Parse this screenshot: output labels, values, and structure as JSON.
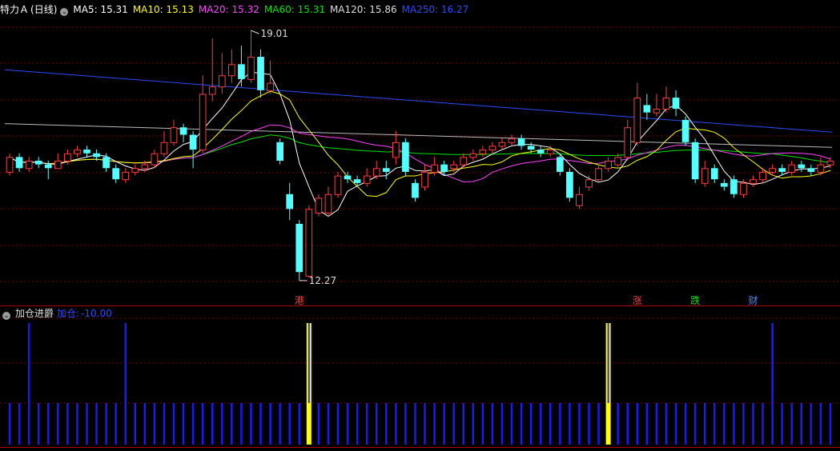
{
  "header": {
    "stock_name": "特力Ａ",
    "period": "(日线)",
    "ma": [
      {
        "label": "MA5: 15.31",
        "color": "#ffffff"
      },
      {
        "label": "MA10: 15.13",
        "color": "#ffff00"
      },
      {
        "label": "MA20: 15.32",
        "color": "#ff44ff"
      },
      {
        "label": "MA60: 15.31",
        "color": "#00e400"
      },
      {
        "label": "MA120: 15.86",
        "color": "#dddddd"
      },
      {
        "label": "MA250: 16.27",
        "color": "#2a4bff"
      }
    ]
  },
  "indicator": {
    "name": "加仓进爵",
    "label": "加仓:",
    "value": "-10.00"
  },
  "bottom_cut": "...",
  "chart_data": {
    "type": "candlestick",
    "price_range": [
      11.6,
      19.4
    ],
    "high_marker": "19.01",
    "low_marker": "12.27",
    "high_index": 25,
    "low_index": 30,
    "events": [
      {
        "index": 30,
        "text": "港",
        "color": "#ff4040"
      },
      {
        "index": 65,
        "text": "涨",
        "color": "#ff4040"
      },
      {
        "index": 71,
        "text": "跌",
        "color": "#00e400"
      },
      {
        "index": 77,
        "text": "财",
        "color": "#4a8cff"
      }
    ],
    "colors": {
      "up": "#ff3c3c",
      "down": "#54ffff",
      "grid": "#7a0000",
      "border": "#b00000"
    },
    "candles": [
      [
        15.2,
        15.6,
        15.7,
        15.1
      ],
      [
        15.6,
        15.3,
        15.7,
        15.2
      ],
      [
        15.3,
        15.5,
        15.6,
        15.2
      ],
      [
        15.5,
        15.4,
        15.6,
        15.3
      ],
      [
        15.4,
        15.3,
        15.5,
        15.0
      ],
      [
        15.3,
        15.5,
        15.7,
        15.3
      ],
      [
        15.5,
        15.7,
        15.8,
        15.4
      ],
      [
        15.7,
        15.8,
        15.9,
        15.6
      ],
      [
        15.8,
        15.7,
        15.9,
        15.6
      ],
      [
        15.7,
        15.6,
        15.8,
        15.5
      ],
      [
        15.6,
        15.3,
        15.7,
        15.2
      ],
      [
        15.3,
        15.0,
        15.4,
        14.9
      ],
      [
        15.0,
        15.2,
        15.3,
        14.9
      ],
      [
        15.2,
        15.3,
        15.4,
        15.1
      ],
      [
        15.3,
        15.4,
        15.5,
        15.2
      ],
      [
        15.4,
        15.7,
        15.8,
        15.3
      ],
      [
        15.7,
        16.0,
        16.3,
        15.6
      ],
      [
        16.0,
        16.4,
        16.6,
        15.9
      ],
      [
        16.4,
        16.2,
        16.5,
        16.0
      ],
      [
        16.2,
        15.8,
        16.3,
        15.3
      ],
      [
        15.8,
        17.3,
        17.8,
        15.7
      ],
      [
        17.3,
        17.5,
        18.8,
        17.1
      ],
      [
        17.5,
        17.8,
        18.4,
        17.3
      ],
      [
        17.8,
        18.1,
        18.5,
        17.6
      ],
      [
        18.1,
        17.7,
        18.6,
        17.5
      ],
      [
        17.7,
        18.3,
        19.01,
        17.6
      ],
      [
        18.3,
        17.4,
        18.5,
        17.2
      ],
      [
        17.4,
        17.6,
        18.2,
        17.3
      ],
      [
        16.0,
        15.5,
        16.1,
        15.4
      ],
      [
        14.6,
        14.2,
        14.9,
        13.9
      ],
      [
        13.8,
        12.5,
        13.9,
        12.27
      ],
      [
        12.4,
        14.2,
        14.3,
        12.35
      ],
      [
        14.1,
        14.5,
        14.6,
        14.0
      ],
      [
        14.1,
        14.6,
        14.8,
        14.0
      ],
      [
        14.6,
        15.1,
        15.2,
        14.5
      ],
      [
        15.1,
        15.0,
        15.2,
        14.9
      ],
      [
        15.0,
        14.9,
        15.1,
        14.8
      ],
      [
        14.9,
        15.1,
        15.3,
        14.8
      ],
      [
        15.1,
        15.3,
        15.5,
        15.0
      ],
      [
        15.3,
        15.2,
        15.5,
        15.0
      ],
      [
        15.6,
        16.0,
        16.3,
        15.4
      ],
      [
        16.0,
        15.2,
        16.1,
        15.1
      ],
      [
        14.9,
        14.5,
        15.0,
        14.4
      ],
      [
        14.8,
        15.2,
        15.4,
        14.7
      ],
      [
        15.2,
        15.4,
        15.6,
        15.1
      ],
      [
        15.4,
        15.2,
        15.5,
        15.1
      ],
      [
        15.3,
        15.4,
        15.5,
        15.2
      ],
      [
        15.4,
        15.6,
        15.7,
        15.3
      ],
      [
        15.6,
        15.7,
        15.8,
        15.5
      ],
      [
        15.7,
        15.8,
        15.9,
        15.6
      ],
      [
        15.8,
        15.9,
        16.0,
        15.7
      ],
      [
        15.9,
        16.0,
        16.1,
        15.8
      ],
      [
        16.0,
        16.1,
        16.2,
        15.9
      ],
      [
        16.1,
        15.9,
        16.2,
        15.8
      ],
      [
        15.9,
        15.8,
        16.0,
        15.7
      ],
      [
        15.8,
        15.7,
        15.9,
        15.6
      ],
      [
        15.7,
        15.8,
        15.9,
        15.6
      ],
      [
        15.6,
        15.2,
        15.7,
        15.1
      ],
      [
        15.2,
        14.5,
        15.3,
        14.4
      ],
      [
        14.3,
        14.6,
        14.8,
        14.2
      ],
      [
        14.8,
        15.0,
        15.1,
        14.7
      ],
      [
        15.0,
        15.3,
        15.4,
        14.9
      ],
      [
        15.3,
        15.5,
        15.6,
        15.2
      ],
      [
        15.4,
        15.6,
        15.7,
        15.3
      ],
      [
        15.6,
        16.4,
        16.6,
        15.5
      ],
      [
        16.0,
        17.2,
        17.6,
        15.9
      ],
      [
        17.0,
        16.8,
        17.3,
        16.6
      ],
      [
        16.8,
        16.9,
        17.3,
        16.7
      ],
      [
        16.9,
        17.2,
        17.5,
        16.8
      ],
      [
        17.2,
        16.9,
        17.4,
        16.7
      ],
      [
        16.6,
        16.0,
        16.7,
        15.9
      ],
      [
        16.0,
        15.0,
        16.1,
        14.9
      ],
      [
        14.9,
        15.3,
        15.5,
        14.8
      ],
      [
        15.3,
        15.0,
        15.4,
        14.9
      ],
      [
        14.9,
        14.8,
        15.0,
        14.7
      ],
      [
        15.0,
        14.6,
        15.1,
        14.5
      ],
      [
        14.6,
        14.9,
        15.0,
        14.5
      ],
      [
        14.9,
        15.0,
        15.1,
        14.8
      ],
      [
        15.0,
        15.2,
        15.3,
        14.9
      ],
      [
        15.2,
        15.3,
        15.4,
        15.1
      ],
      [
        15.3,
        15.2,
        15.4,
        15.1
      ],
      [
        15.2,
        15.4,
        15.5,
        15.1
      ],
      [
        15.4,
        15.3,
        15.5,
        15.2
      ],
      [
        15.3,
        15.2,
        15.4,
        15.1
      ],
      [
        15.2,
        15.4,
        15.6,
        15.1
      ],
      [
        15.4,
        15.5,
        15.6,
        15.3
      ]
    ],
    "ma250": {
      "start": 17.95,
      "end": 16.27
    },
    "ma120": {
      "start": 16.5,
      "end": 15.86
    },
    "signal": {
      "tall_blue_index": [
        2,
        12,
        79
      ],
      "yellow_index": [
        31,
        62
      ]
    }
  }
}
